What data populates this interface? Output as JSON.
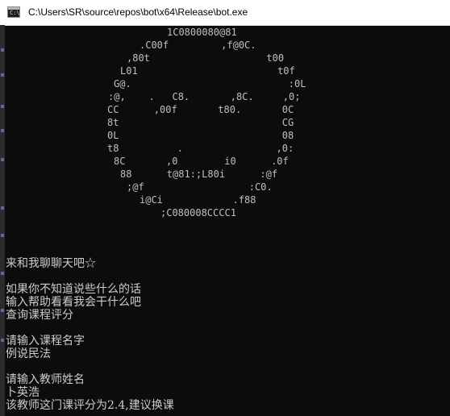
{
  "window": {
    "title": "C:\\Users\\SR\\source\\repos\\bot\\x64\\Release\\bot.exe",
    "icon": "console-app-icon",
    "icon_glyph": "C:\\"
  },
  "ascii_art": [
    "1C0800080@81",
    ".C00f         ,f@0C.",
    ",80t                    t00",
    "L01                        t0f",
    "G@.                           :0L",
    ":@,    .   C8.       ,8C.     ,0;",
    "CC      ,00f       t80.       0C",
    "8t                            CG",
    "0L                            08",
    "t8          .                ,0:",
    "8C       ,0        i0      .0f",
    "88      t@81:;L80i      :@f",
    ";@f                  :C0.",
    "i@Ci            .f88",
    ";C080008CCCC1"
  ],
  "messages": [
    "来和我聊聊天吧☆",
    "",
    "如果你不知道说些什么的话",
    "输入帮助看看我会干什么吧",
    "查询课程评分",
    "",
    "请输入课程名字",
    "例说民法",
    "",
    "请输入教师姓名",
    "卜英浩",
    "该教师这门课评分为2.4,建议换课"
  ],
  "colors": {
    "console_bg": "#0c0c0c",
    "console_text": "#c0c0c0",
    "titlebar_bg": "#ffffff"
  }
}
